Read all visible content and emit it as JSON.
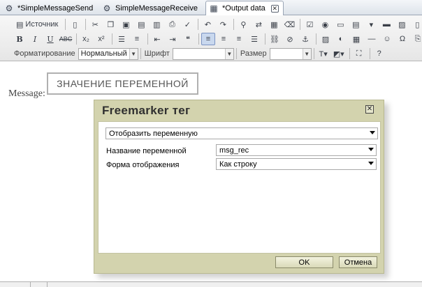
{
  "tabs": [
    {
      "label": "*SimpleMessageSend",
      "icon": "gear-icon",
      "active": false
    },
    {
      "label": "SimpleMessageReceive",
      "icon": "gear-icon",
      "active": false
    },
    {
      "label": "*Output data",
      "icon": "html-file-icon",
      "active": true
    }
  ],
  "toolbar": {
    "source_label": "Источник",
    "format_label": "Форматирование",
    "format_value": "Нормальный",
    "font_label": "Шрифт",
    "font_value": "",
    "size_label": "Размер",
    "size_value": "",
    "buttons_row1": [
      "source-icon",
      "document-icon",
      "cut-icon",
      "copy-icon",
      "paste-icon",
      "paste-text-icon",
      "paste-word-icon",
      "print-icon",
      "spellcheck-icon",
      "undo-icon",
      "redo-icon",
      "find-icon",
      "replace-icon",
      "select-all-icon",
      "remove-format-icon",
      "checkbox-icon",
      "radio-icon",
      "textfield-icon",
      "textarea-icon",
      "select-icon",
      "button-icon",
      "image-button-icon",
      "hidden-field-icon",
      "code-icon"
    ],
    "buttons_row2": [
      "bold-icon",
      "italic-icon",
      "underline-icon",
      "strike-icon",
      "subscript-icon",
      "superscript-icon",
      "ordered-list-icon",
      "bullet-list-icon",
      "outdent-icon",
      "indent-icon",
      "blockquote-icon",
      "align-left-icon",
      "align-center-icon",
      "align-right-icon",
      "justify-icon",
      "link-icon",
      "unlink-icon",
      "anchor-icon",
      "image-icon",
      "flash-icon",
      "table-icon",
      "hr-icon",
      "smiley-icon",
      "special-char-icon",
      "pagebreak-icon"
    ]
  },
  "content": {
    "message_label": "Message:",
    "variable_placeholder": "ЗНАЧЕНИЕ ПЕРЕМЕННОЙ"
  },
  "dialog": {
    "title": "Freemarker тег",
    "tag_type": "Отобразить переменную",
    "variable_name_label": "Название переменной",
    "variable_name_value": "msg_rec",
    "display_form_label": "Форма отображения",
    "display_form_value": "Как строку",
    "ok_label": "OK",
    "cancel_label": "Отмена"
  }
}
